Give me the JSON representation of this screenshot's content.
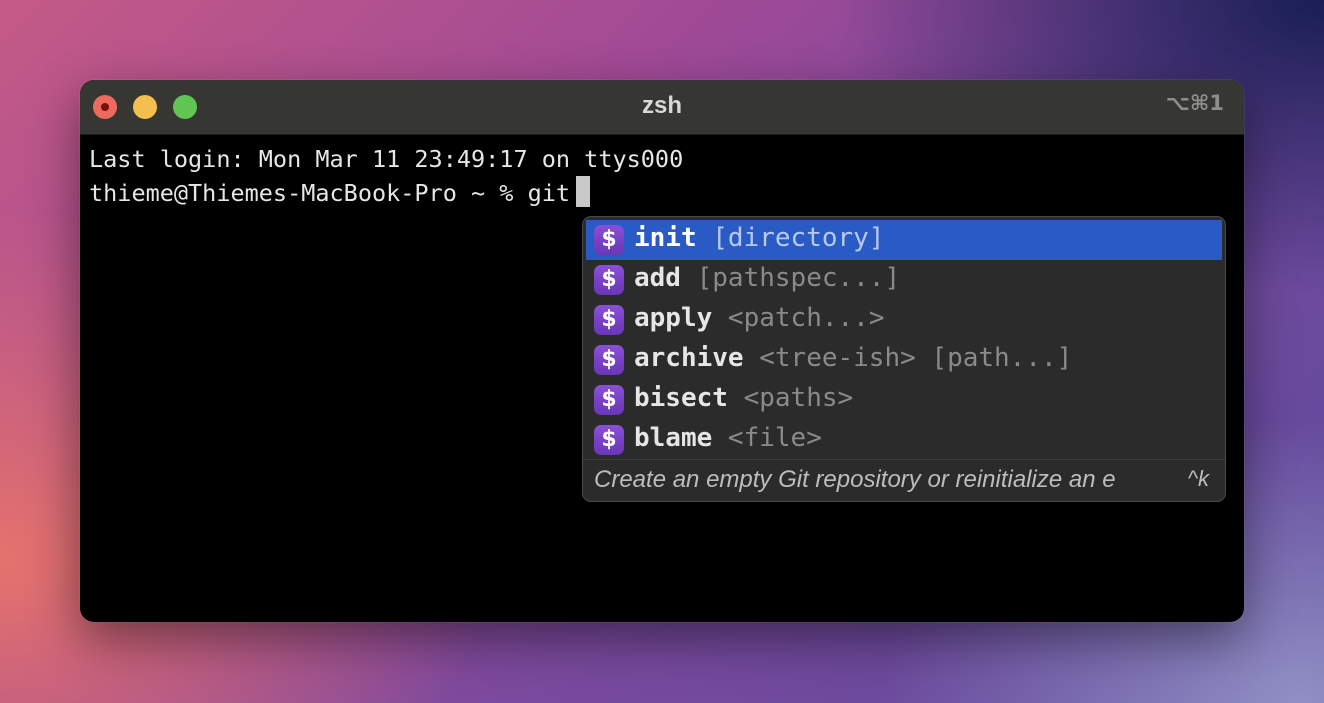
{
  "window": {
    "title": "zsh",
    "shortcut": "⌥⌘1"
  },
  "terminal": {
    "last_login": "Last login: Mon Mar 11 23:49:17 on ttys000",
    "prompt": "thieme@Thiemes-MacBook-Pro ~ % ",
    "typed": "git"
  },
  "autocomplete": {
    "badge_symbol": "$",
    "items": [
      {
        "command": "init",
        "args": " [directory]",
        "selected": true
      },
      {
        "command": "add",
        "args": " [pathspec...]"
      },
      {
        "command": "apply",
        "args": " <patch...>"
      },
      {
        "command": "archive",
        "args": " <tree-ish> [path...]"
      },
      {
        "command": "bisect",
        "args": " <paths>"
      },
      {
        "command": "blame",
        "args": " <file>"
      }
    ],
    "description": "Create an empty Git repository or reinitialize an e",
    "description_key": "^k",
    "selected_color": "#2a5ac3",
    "badge_color": "#7b45c8"
  },
  "colors": {
    "close": "#ed6a5e",
    "minimize": "#f5bf4f",
    "maximize": "#61c554"
  }
}
